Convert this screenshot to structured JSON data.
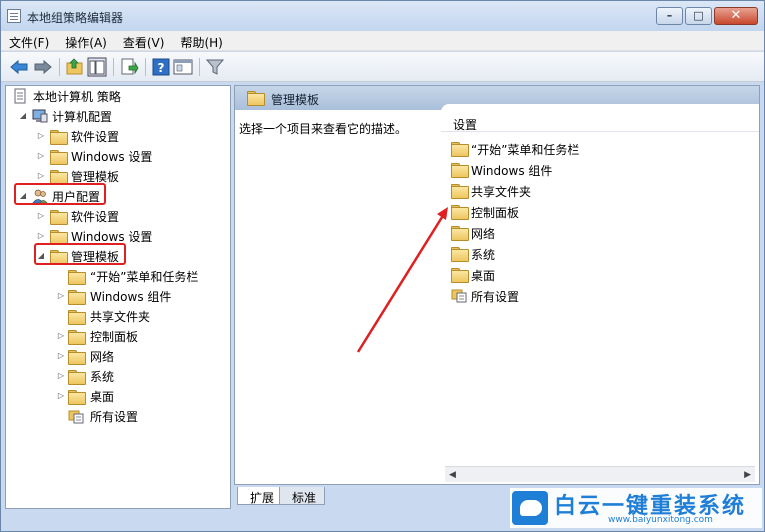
{
  "window": {
    "title": "本地组策略编辑器",
    "minimize_glyph": "–",
    "maximize_glyph": "□",
    "close_glyph": "✕"
  },
  "menu": [
    "文件(F)",
    "操作(A)",
    "查看(V)",
    "帮助(H)"
  ],
  "tree": {
    "root": "本地计算机 策略",
    "computer_config": "计算机配置",
    "computer_children": [
      "软件设置",
      "Windows 设置",
      "管理模板"
    ],
    "user_config": "用户配置",
    "user_children": [
      "软件设置",
      "Windows 设置"
    ],
    "user_admin_templates": "管理模板",
    "admin_template_children": [
      "“开始”菜单和任务栏",
      "Windows 组件",
      "共享文件夹",
      "控制面板",
      "网络",
      "系统",
      "桌面",
      "所有设置"
    ]
  },
  "right_pane": {
    "header": "管理模板",
    "description": "选择一个项目来查看它的描述。",
    "column_header": "设置",
    "items": [
      "“开始”菜单和任务栏",
      "Windows 组件",
      "共享文件夹",
      "控制面板",
      "网络",
      "系统",
      "桌面",
      "所有设置"
    ]
  },
  "tabs": [
    "扩展",
    "标准"
  ],
  "watermark": {
    "title": "白云一键重装系统",
    "url": "www.baiyunxitong.com"
  },
  "colors": {
    "highlight": "#e02020",
    "accent": "#1f7fd6"
  }
}
